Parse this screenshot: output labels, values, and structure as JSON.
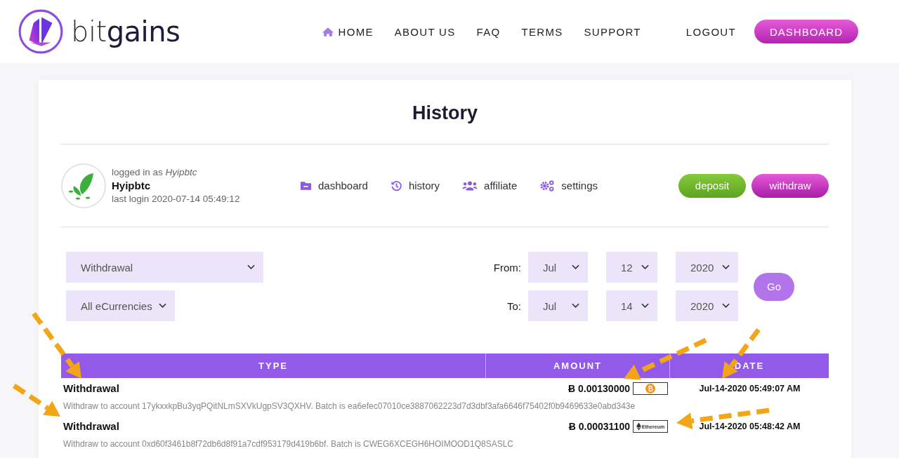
{
  "brand": {
    "name_light": "bit",
    "name_bold": "gains"
  },
  "nav": [
    {
      "label": "HOME",
      "kind": "home"
    },
    {
      "label": "ABOUT US",
      "kind": "plain"
    },
    {
      "label": "FAQ",
      "kind": "plain"
    },
    {
      "label": "TERMS",
      "kind": "plain"
    },
    {
      "label": "SUPPORT",
      "kind": "plain"
    }
  ],
  "logout": "LOGOUT",
  "dashboard_button": "DASHBOARD",
  "page_title": "History",
  "user": {
    "logged_in_as": "logged in as *Hyipbtc*",
    "username": "Hyipbtc",
    "last_login": "last login 2020-07-14 05:49:12"
  },
  "user_menu": [
    {
      "label": "dashboard",
      "kind": "folder"
    },
    {
      "label": "history",
      "kind": "history"
    },
    {
      "label": "affiliate",
      "kind": "users"
    },
    {
      "label": "settings",
      "kind": "gears"
    }
  ],
  "actions": [
    {
      "label": "deposit",
      "kind": "deposit"
    },
    {
      "label": "withdraw",
      "kind": "withdraw"
    }
  ],
  "filters": {
    "type": "Withdrawal",
    "currency": "All eCurrencies",
    "from": {
      "label": "From:",
      "month": "Jul",
      "day": "12",
      "year": "2020"
    },
    "to": {
      "label": "To:",
      "month": "Jul",
      "day": "14",
      "year": "2020"
    },
    "go": "Go"
  },
  "table": {
    "columns": [
      "TYPE",
      "AMOUNT",
      "DATE"
    ],
    "rows": [
      {
        "type": "Withdrawal",
        "amount": "Ƀ 0.00130000",
        "currency": {
          "kind": "bitcoin"
        },
        "date": "Jul-14-2020 05:49:07 AM",
        "description": "Withdraw to account 17ykxxkpBu3yqPQitNLmSXVkUgpSV3QXHV. Batch is ea6efec07010ce3887062223d7d3dbf3afa6646f75402f0b9469633e0abd343e"
      },
      {
        "type": "Withdrawal",
        "amount": "Ƀ 0.00031100",
        "currency": {
          "kind": "ethereum",
          "label": "Ethereum"
        },
        "date": "Jul-14-2020 05:48:42 AM",
        "description": "Withdraw to account 0xd60f3461b8f72db6d8f91a7cdf953179d419b6bf. Batch is CWEG6XCEGH6HOIMOOD1Q8SASLC"
      }
    ]
  }
}
